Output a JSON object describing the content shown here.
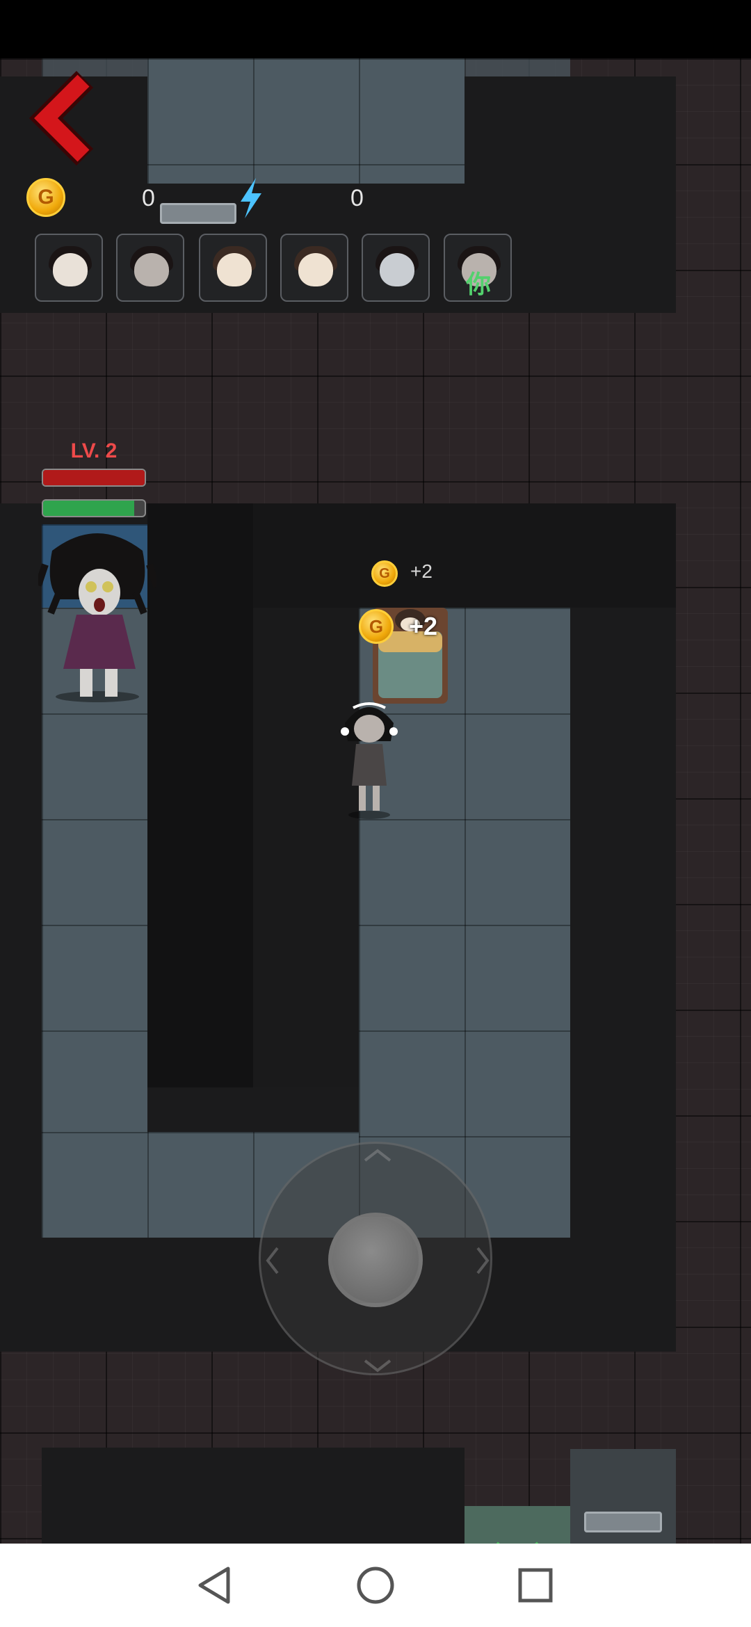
{
  "hud": {
    "back_icon": "chevron-left-icon",
    "coins": "0",
    "energy": "0",
    "coin_letter": "G"
  },
  "party": [
    {
      "name": "boy",
      "hair": "black"
    },
    {
      "name": "girl-ribbons",
      "hair": "black"
    },
    {
      "name": "girl-brown",
      "hair": "brown"
    },
    {
      "name": "girl-brown-2",
      "hair": "brown"
    },
    {
      "name": "pale-girl",
      "hair": "black"
    },
    {
      "name": "you",
      "hair": "black",
      "tag": "你"
    }
  ],
  "enemy": {
    "level_label": "LV. 2",
    "health": 1.0,
    "stamina": 0.9
  },
  "rewards": {
    "float_small": "+2",
    "float_big": "+2"
  },
  "colors": {
    "back_red": "#d4161b",
    "health_red": "#b11a1a",
    "stamina_green": "#2fa44d",
    "you_green": "#53d16d",
    "energy_blue": "#4cc3ff"
  },
  "nav": {
    "back": "triangle-back-icon",
    "home": "circle-home-icon",
    "recents": "square-recents-icon"
  }
}
